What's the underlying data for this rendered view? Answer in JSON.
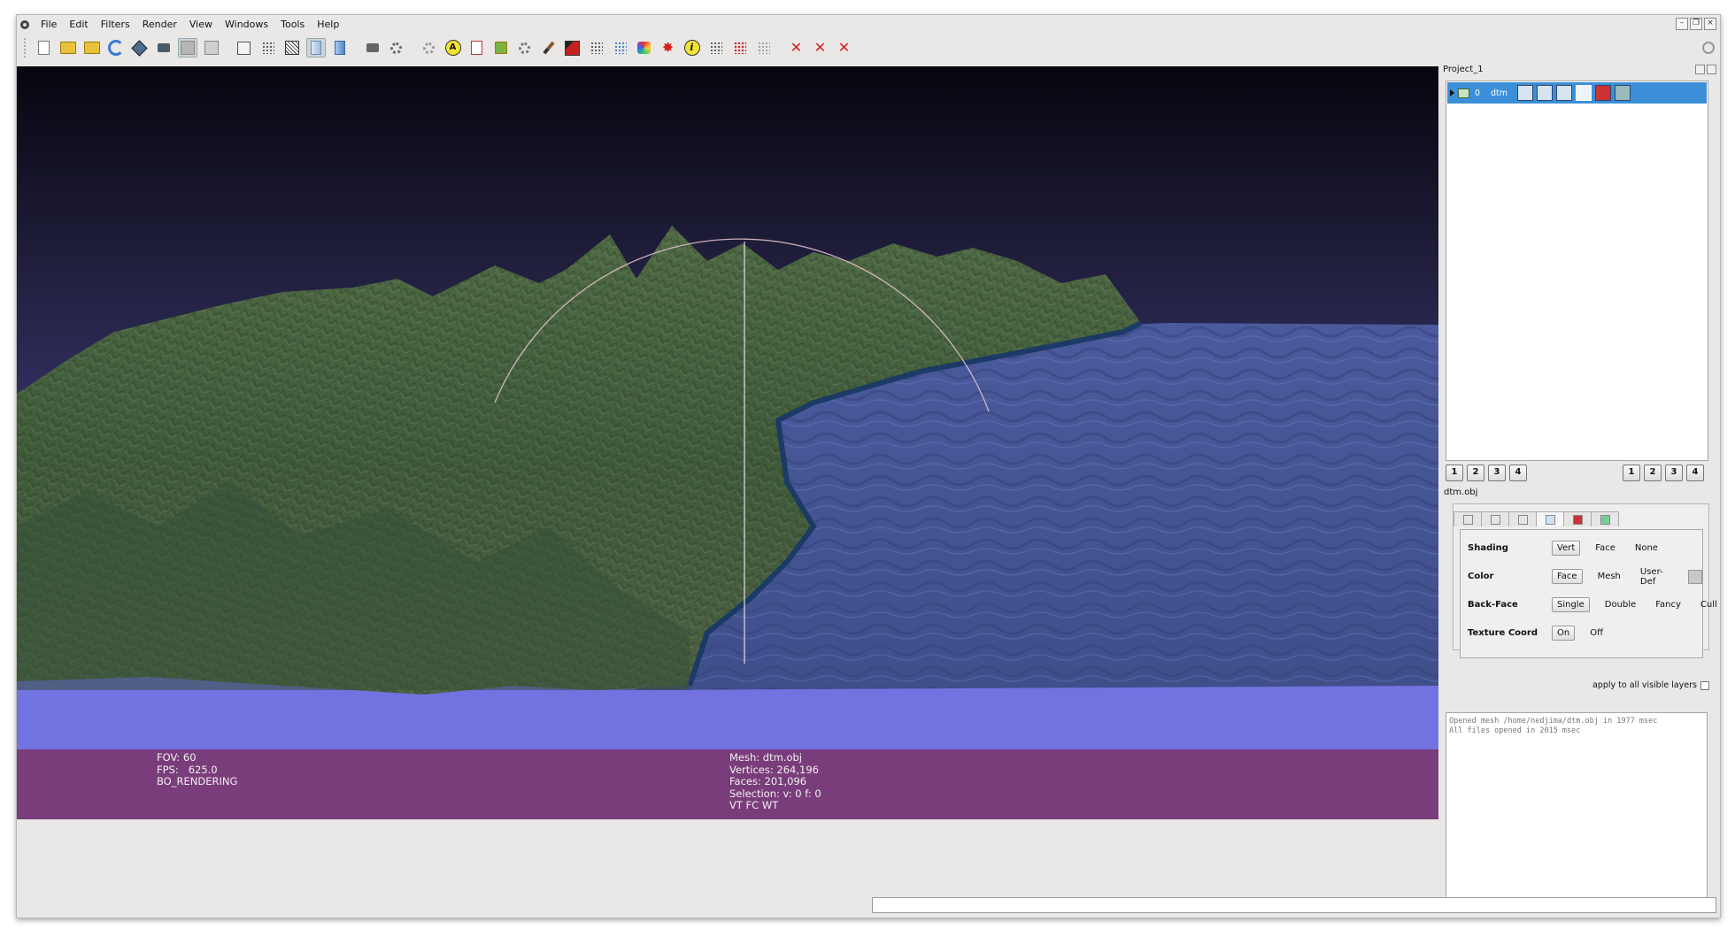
{
  "menu": [
    "File",
    "Edit",
    "Filters",
    "Render",
    "View",
    "Windows",
    "Tools",
    "Help"
  ],
  "toolbar": {
    "buttons": [
      "new-project-icon",
      "open-project-icon",
      "open-mesh-icon",
      "reload-icon",
      "export-icon",
      "snapshot-icon",
      "bbox-icon",
      "points-icon",
      "box-icon",
      "vertex-dots-icon",
      "wireframe-icon",
      "flat-shading-icon",
      "smooth-shading-icon",
      "layers-icon",
      "edit-tool-icon",
      "measure-tool-icon",
      "annotation-a-icon",
      "pick-points-icon",
      "paint-icon",
      "brush-icon",
      "texture-red-icon",
      "select-vertices-icon",
      "select-faces-icon",
      "colorize-icon",
      "align-icon",
      "info-icon",
      "select-connected-icon",
      "select-red-icon",
      "select-grey-icon",
      "delete-vertices-icon",
      "delete-faces-icon",
      "delete-selection-icon",
      "search-icon"
    ],
    "active": [
      "points-icon",
      "flat-shading-icon"
    ]
  },
  "viewport": {
    "info_left": [
      "FOV: 60",
      "FPS:   625.0",
      "BO_RENDERING"
    ],
    "info_right": [
      "Mesh: dtm.obj",
      "Vertices: 264,196",
      "Faces: 201,096",
      "Selection: v: 0 f: 0",
      "VT FC WT"
    ],
    "colors": {
      "status_band": "#7a3d7b",
      "water": "#5b6fb1",
      "sky_top": "#06060f",
      "sky_bottom": "#5a5bc3"
    }
  },
  "project": {
    "title": "Project_1",
    "layer": {
      "index": "0",
      "name": "dtm"
    },
    "numbers_left": [
      "1",
      "2",
      "3",
      "4"
    ],
    "numbers_right": [
      "1",
      "2",
      "3",
      "4"
    ],
    "mesh_name": "dtm.obj"
  },
  "render": {
    "rows": [
      {
        "label": "Shading",
        "options": [
          "Vert",
          "Face",
          "None"
        ],
        "selected": "Vert"
      },
      {
        "label": "Color",
        "options": [
          "Face",
          "Mesh",
          "User-Def"
        ],
        "selected": "Face"
      },
      {
        "label": "Back-Face",
        "options": [
          "Single",
          "Double",
          "Fancy",
          "Cull"
        ],
        "selected": "Single"
      },
      {
        "label": "Texture Coord",
        "options": [
          "On",
          "Off"
        ],
        "selected": "On"
      }
    ],
    "apply_label": "apply to all visible layers"
  },
  "log": [
    "Opened mesh /home/nedjima/dtm.obj in 1977 msec",
    "All files opened in 2015 msec"
  ]
}
